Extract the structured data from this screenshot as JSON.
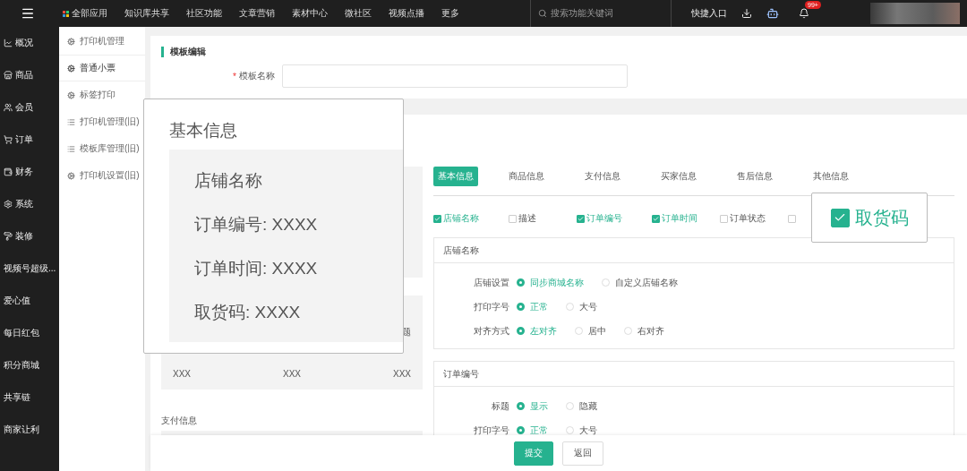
{
  "top_bar": {
    "nav": [
      {
        "label": "全部应用"
      },
      {
        "label": "知识库共享"
      },
      {
        "label": "社区功能"
      },
      {
        "label": "文章营销"
      },
      {
        "label": "素材中心"
      },
      {
        "label": "微社区"
      },
      {
        "label": "视频点播"
      },
      {
        "label": "更多"
      }
    ],
    "search": {
      "placeholder": "搜索功能关键词"
    },
    "quick_entry": "快捷入口",
    "notifications_badge": "99+"
  },
  "sidebar": {
    "items": [
      {
        "label": "概况"
      },
      {
        "label": "商品"
      },
      {
        "label": "会员"
      },
      {
        "label": "订单"
      },
      {
        "label": "财务"
      },
      {
        "label": "系统"
      },
      {
        "label": "装修"
      },
      {
        "label": "视频号超级..."
      },
      {
        "label": "爱心值"
      },
      {
        "label": "每日红包"
      },
      {
        "label": "积分商城"
      },
      {
        "label": "共享链"
      },
      {
        "label": "商家让利"
      }
    ]
  },
  "submenu": {
    "items": [
      {
        "label": "打印机管理",
        "selected": false
      },
      {
        "label": "普通小票",
        "selected": true
      },
      {
        "label": "标签打印",
        "selected": false
      },
      {
        "label": "打印机管理(旧)",
        "selected": false
      },
      {
        "label": "模板库管理(旧)",
        "selected": false
      },
      {
        "label": "打印机设置(旧)",
        "selected": false
      }
    ]
  },
  "template_card": {
    "title": "模板编辑",
    "name_field": {
      "label": "模板名称",
      "required_mark": "*"
    }
  },
  "preview": {
    "label_fragment": "题",
    "row": [
      "XXX",
      "XXX",
      "XXX"
    ],
    "payment_label": "支付信息"
  },
  "tabs": [
    {
      "label": "基本信息",
      "selected": true
    },
    {
      "label": "商品信息",
      "selected": false
    },
    {
      "label": "支付信息",
      "selected": false
    },
    {
      "label": "买家信息",
      "selected": false
    },
    {
      "label": "售后信息",
      "selected": false
    },
    {
      "label": "其他信息",
      "selected": false
    }
  ],
  "fields": [
    {
      "label": "店铺名称",
      "checked": true
    },
    {
      "label": "描述",
      "checked": false
    },
    {
      "label": "订单编号",
      "checked": true
    },
    {
      "label": "订单时间",
      "checked": true
    },
    {
      "label": "订单状态",
      "checked": false
    },
    {
      "checked": false
    }
  ],
  "sections": [
    {
      "title": "店铺名称",
      "rows": [
        {
          "label": "店铺设置",
          "options": [
            {
              "label": "同步商城名称",
              "selected": true
            },
            {
              "label": "自定义店铺名称",
              "selected": false
            }
          ]
        },
        {
          "label": "打印字号",
          "options": [
            {
              "label": "正常",
              "selected": true
            },
            {
              "label": "大号",
              "selected": false
            }
          ]
        },
        {
          "label": "对齐方式",
          "options": [
            {
              "label": "左对齐",
              "selected": true
            },
            {
              "label": "居中",
              "selected": false
            },
            {
              "label": "右对齐",
              "selected": false
            }
          ]
        }
      ]
    },
    {
      "title": "订单编号",
      "rows": [
        {
          "label": "标题",
          "options": [
            {
              "label": "显示",
              "selected": true
            },
            {
              "label": "隐藏",
              "selected": false
            }
          ]
        },
        {
          "label": "打印字号",
          "options": [
            {
              "label": "正常",
              "selected": true
            },
            {
              "label": "大号",
              "selected": false
            }
          ]
        }
      ]
    }
  ],
  "footer": {
    "buttons": [
      {
        "label": "提交",
        "kind": "primary"
      },
      {
        "label": "返回",
        "kind": "default"
      }
    ]
  },
  "zoom_popup": {
    "title": "基本信息",
    "lines": [
      "店铺名称",
      "订单编号: XXXX",
      "订单时间: XXXX",
      "取货码: XXXX"
    ]
  },
  "field_popup": {
    "label": "取货码",
    "checked": true
  }
}
